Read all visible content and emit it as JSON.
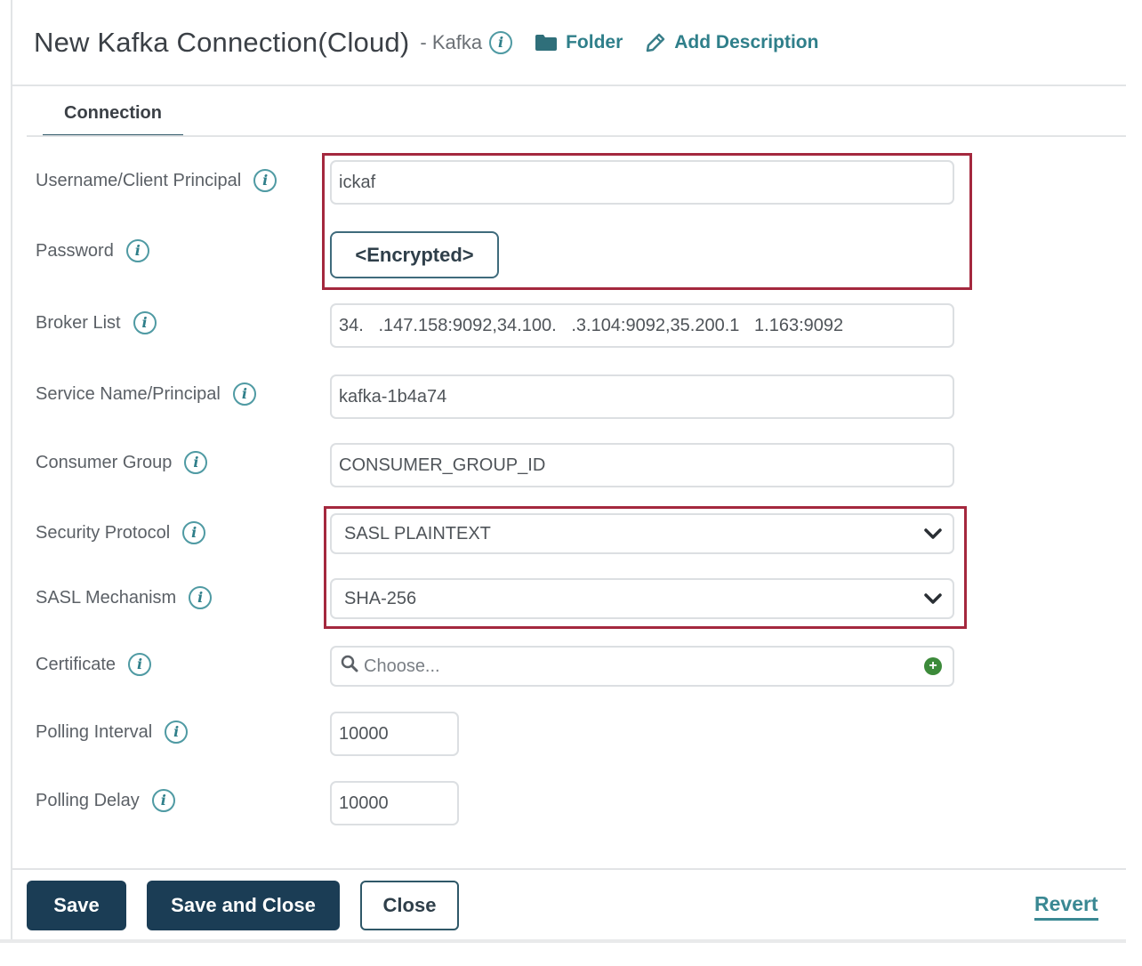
{
  "header": {
    "title": "New Kafka Connection(Cloud)",
    "subtitle": "- Kafka",
    "info_icon": "info-icon",
    "folder_label": "Folder",
    "folder_icon": "folder-icon",
    "add_description_label": "Add Description",
    "add_description_icon": "pencil-icon"
  },
  "tabs": [
    {
      "label": "Connection",
      "active": true
    }
  ],
  "form": {
    "username": {
      "label": "Username/Client Principal",
      "value": "ickaf"
    },
    "password": {
      "label": "Password",
      "value": "<Encrypted>"
    },
    "broker_list": {
      "label": "Broker List",
      "value": "34.   .147.158:9092,34.100.   .3.104:9092,35.200.1   1.163:9092"
    },
    "service_name": {
      "label": "Service Name/Principal",
      "value": "kafka-1b4a74"
    },
    "consumer_group": {
      "label": "Consumer Group",
      "value": "CONSUMER_GROUP_ID"
    },
    "security_protocol": {
      "label": "Security Protocol",
      "selected": "SASL PLAINTEXT"
    },
    "sasl_mechanism": {
      "label": "SASL Mechanism",
      "selected": "SHA-256"
    },
    "certificate": {
      "label": "Certificate",
      "placeholder": "Choose...",
      "add_icon": "plus-circle-icon",
      "search_icon": "search-icon"
    },
    "polling_interval": {
      "label": "Polling Interval",
      "value": "10000"
    },
    "polling_delay": {
      "label": "Polling Delay",
      "value": "10000"
    }
  },
  "info_glyph": "i",
  "footer": {
    "save_label": "Save",
    "save_and_close_label": "Save and Close",
    "close_label": "Close",
    "revert_label": "Revert"
  },
  "colors": {
    "accent": "#2f7f8a",
    "primary_button": "#1b3d55",
    "highlight_box": "#a4283e",
    "add_icon": "#3c8a3a"
  }
}
